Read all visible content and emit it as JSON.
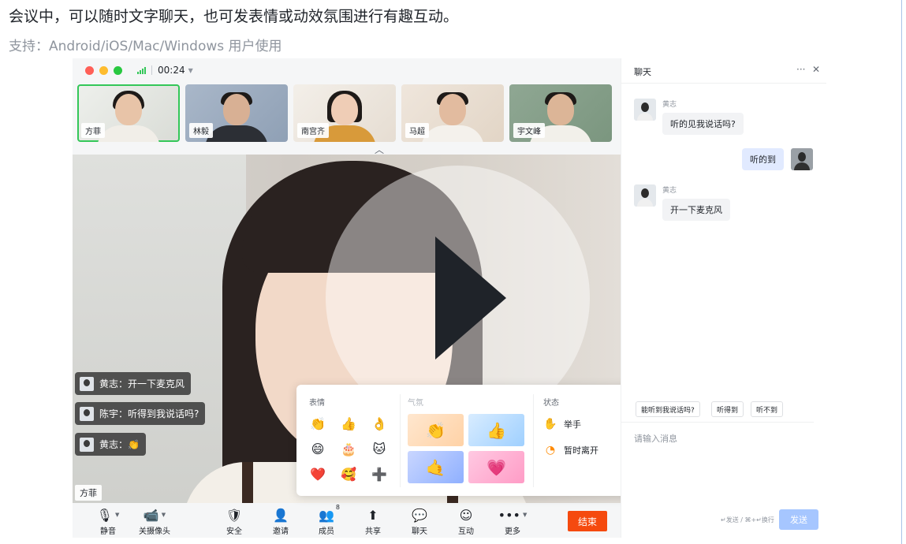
{
  "intro": {
    "headline": "会议中，可以随时文字聊天，也可发表情或动效氛围进行有趣互动。",
    "support": "支持：Android/iOS/Mac/Windows 用户使用"
  },
  "meeting": {
    "timer": "00:24",
    "participants": [
      {
        "name": "方菲"
      },
      {
        "name": "林毅"
      },
      {
        "name": "南宫齐"
      },
      {
        "name": "马超"
      },
      {
        "name": "宇文峰"
      }
    ],
    "overlay_messages": [
      {
        "text": "黄志：开一下麦克风"
      },
      {
        "text": "陈宇：听得到我说话吗?"
      },
      {
        "text": "黄志：👏"
      }
    ],
    "speaker_name": "方菲",
    "toolbar": {
      "mute": "静音",
      "camera_off": "关摄像头",
      "security": "安全",
      "invite": "邀请",
      "members": "成员",
      "members_count": "8",
      "share": "共享",
      "chat": "聊天",
      "interact": "互动",
      "more": "更多",
      "end": "结束"
    }
  },
  "reactions": {
    "emoji_title": "表情",
    "atmosphere_title": "气氛",
    "status_title": "状态",
    "emojis": [
      "👏",
      "👍",
      "👌",
      "😄",
      "🎂",
      "🐱",
      "❤️",
      "🥰",
      "➕"
    ],
    "atmospheres": [
      "👏",
      "👍",
      "🤙",
      "💗"
    ],
    "status": {
      "raise_hand": "举手",
      "away": "暂时离开"
    }
  },
  "chat": {
    "title": "聊天",
    "messages": [
      {
        "sender": "黄志",
        "text": "听的见我说话吗?"
      },
      {
        "text": "听的到"
      },
      {
        "sender": "黄志",
        "text": "开一下麦克风"
      }
    ],
    "quick_replies": [
      "能听到我说话吗?",
      "听得到",
      "听不到"
    ],
    "input_placeholder": "请输入消息",
    "hint": "↵发送 / ⌘+↵换行",
    "send": "发送"
  },
  "colors": {
    "accent": "#34c759",
    "end_button": "#f54a0f",
    "send_button": "#a6c6ff",
    "my_bubble": "#e1eaff"
  }
}
